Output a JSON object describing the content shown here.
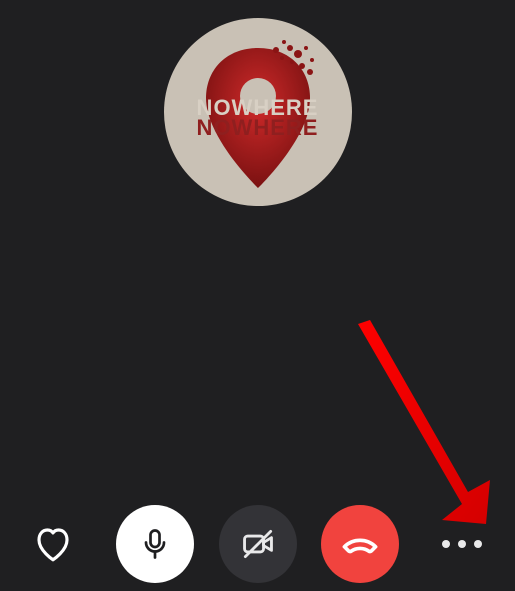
{
  "avatar": {
    "semantic": "contact-avatar",
    "line1": "NOWHERE",
    "line2": "NOWHERE"
  },
  "controls": {
    "react_label": "react",
    "mic_label": "mute-unmute-microphone",
    "video_label": "toggle-video",
    "endcall_label": "end-call",
    "more_label": "more-options"
  },
  "colors": {
    "background": "#1f1f21",
    "mic_button": "#ffffff",
    "video_button": "#333337",
    "end_button": "#f1433e",
    "annotation_arrow": "#ff0000"
  },
  "annotation": {
    "points_to": "more-options-button"
  }
}
